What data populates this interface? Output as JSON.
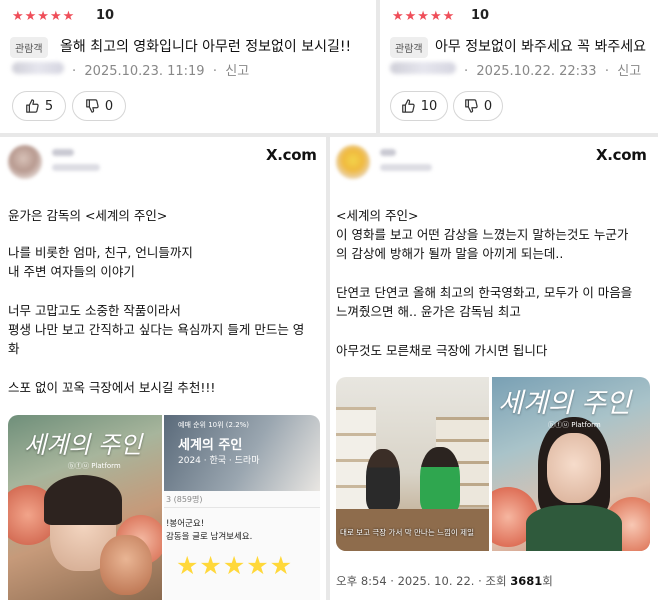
{
  "review_left": {
    "stars": "★★★★★",
    "rating": "10",
    "badge": "관람객",
    "text": "올해 최고의 영화입니다 아무런 정보없이 보시길!!",
    "meta": "2025.10.23. 11:19",
    "report": "신고",
    "likes": "5",
    "dislikes": "0"
  },
  "review_right": {
    "stars": "★★★★★",
    "rating": "10",
    "badge": "관람객",
    "text": "아무 정보없이 봐주세요 꼭 봐주세요",
    "meta": "2025.10.22. 22:33",
    "report": "신고",
    "likes": "10",
    "dislikes": "0"
  },
  "post_left": {
    "source": "X.com",
    "lines": [
      "윤가은 감독의 <세계의 주인>",
      "나를 비롯한 엄마, 친구, 언니들까지",
      "내 주변 여자들의 이야기",
      "너무 고맙고도 소중한 작품이라서",
      "평생 나만 보고 간직하고 싶다는 욕심까지 들게 만드는 영",
      "화",
      "스포 없이 꼬옥 극장에서 보시길 추천!!!"
    ],
    "poster_title": "세계의 주인",
    "poster_brand": "ⓑⓕⓤ Platform",
    "card_badge": "예매 순위 10위 (2.2%)",
    "card_title": "세계의 주인",
    "card_info": "2024 · 한국 · 드라마",
    "card_count": "3 (859명)",
    "sticker_line1": "!봉어군요!",
    "sticker_line2": "감동을 글로 남겨보세요.",
    "sticker_stars": "★★★★★"
  },
  "post_right": {
    "source": "X.com",
    "lines": [
      "<세계의 주인>",
      "이 영화를 보고 어떤 감상을 느꼈는지 말하는것도 누군가",
      "의 감상에 방해가 될까 말을 아끼게 되는데..",
      "단연코 단연코 올해 최고의 한국영화고, 모두가 이 마음을",
      "느껴줬으면 해.. 윤가은 감독님 최고",
      "아무것도 모른채로 극장에 가시면 됩니다"
    ],
    "video_subtitle": "대로 보고 극장 가서 막 만나는 느낌이 제일",
    "poster_title": "세계의 주인",
    "poster_brand": "ⓑⓕⓤ Platform",
    "footer_time": "오후 8:54 · 2025. 10. 22. · 조회 ",
    "footer_views": "3681",
    "footer_unit": "회"
  },
  "colors": {
    "star_red": "#ef4e59",
    "star_yellow": "#ffd83a",
    "muted": "#888888"
  }
}
